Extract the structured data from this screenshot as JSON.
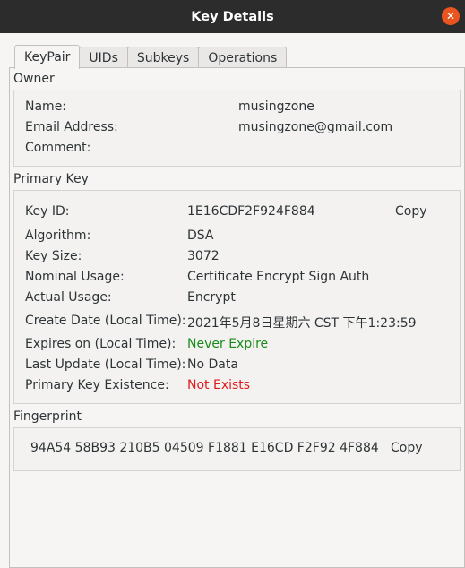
{
  "window": {
    "title": "Key Details",
    "close_icon": "close-icon",
    "close_color": "#e95420"
  },
  "tabs": [
    {
      "label": "KeyPair",
      "active": true
    },
    {
      "label": "UIDs",
      "active": false
    },
    {
      "label": "Subkeys",
      "active": false
    },
    {
      "label": "Operations",
      "active": false
    }
  ],
  "owner": {
    "title": "Owner",
    "name_label": "Name:",
    "name_value": "musingzone",
    "email_label": "Email Address:",
    "email_value": "musingzone@gmail.com",
    "comment_label": "Comment:",
    "comment_value": ""
  },
  "primary_key": {
    "title": "Primary Key",
    "key_id_label": "Key ID:",
    "key_id_value": "1E16CDF2F924F884",
    "copy_label": "Copy",
    "algorithm_label": "Algorithm:",
    "algorithm_value": "DSA",
    "key_size_label": "Key Size:",
    "key_size_value": "3072",
    "nominal_usage_label": "Nominal Usage:",
    "nominal_usage_value": "Certificate Encrypt Sign Auth",
    "actual_usage_label": "Actual Usage:",
    "actual_usage_value": "Encrypt",
    "create_date_label": "Create Date (Local Time):",
    "create_date_value": "2021年5月8日星期六 CST 下午1:23:59",
    "expires_label": "Expires on (Local Time):",
    "expires_value": "Never Expire",
    "expires_color": "#1a8a1a",
    "last_update_label": "Last Update (Local Time):",
    "last_update_value": "No Data",
    "existence_label": "Primary Key Existence:",
    "existence_value": "Not Exists",
    "existence_color": "#e01b1b"
  },
  "fingerprint": {
    "title": "Fingerprint",
    "value": "94A54 58B93 210B5 04509 F1881 E16CD F2F92 4F884",
    "copy_label": "Copy"
  }
}
